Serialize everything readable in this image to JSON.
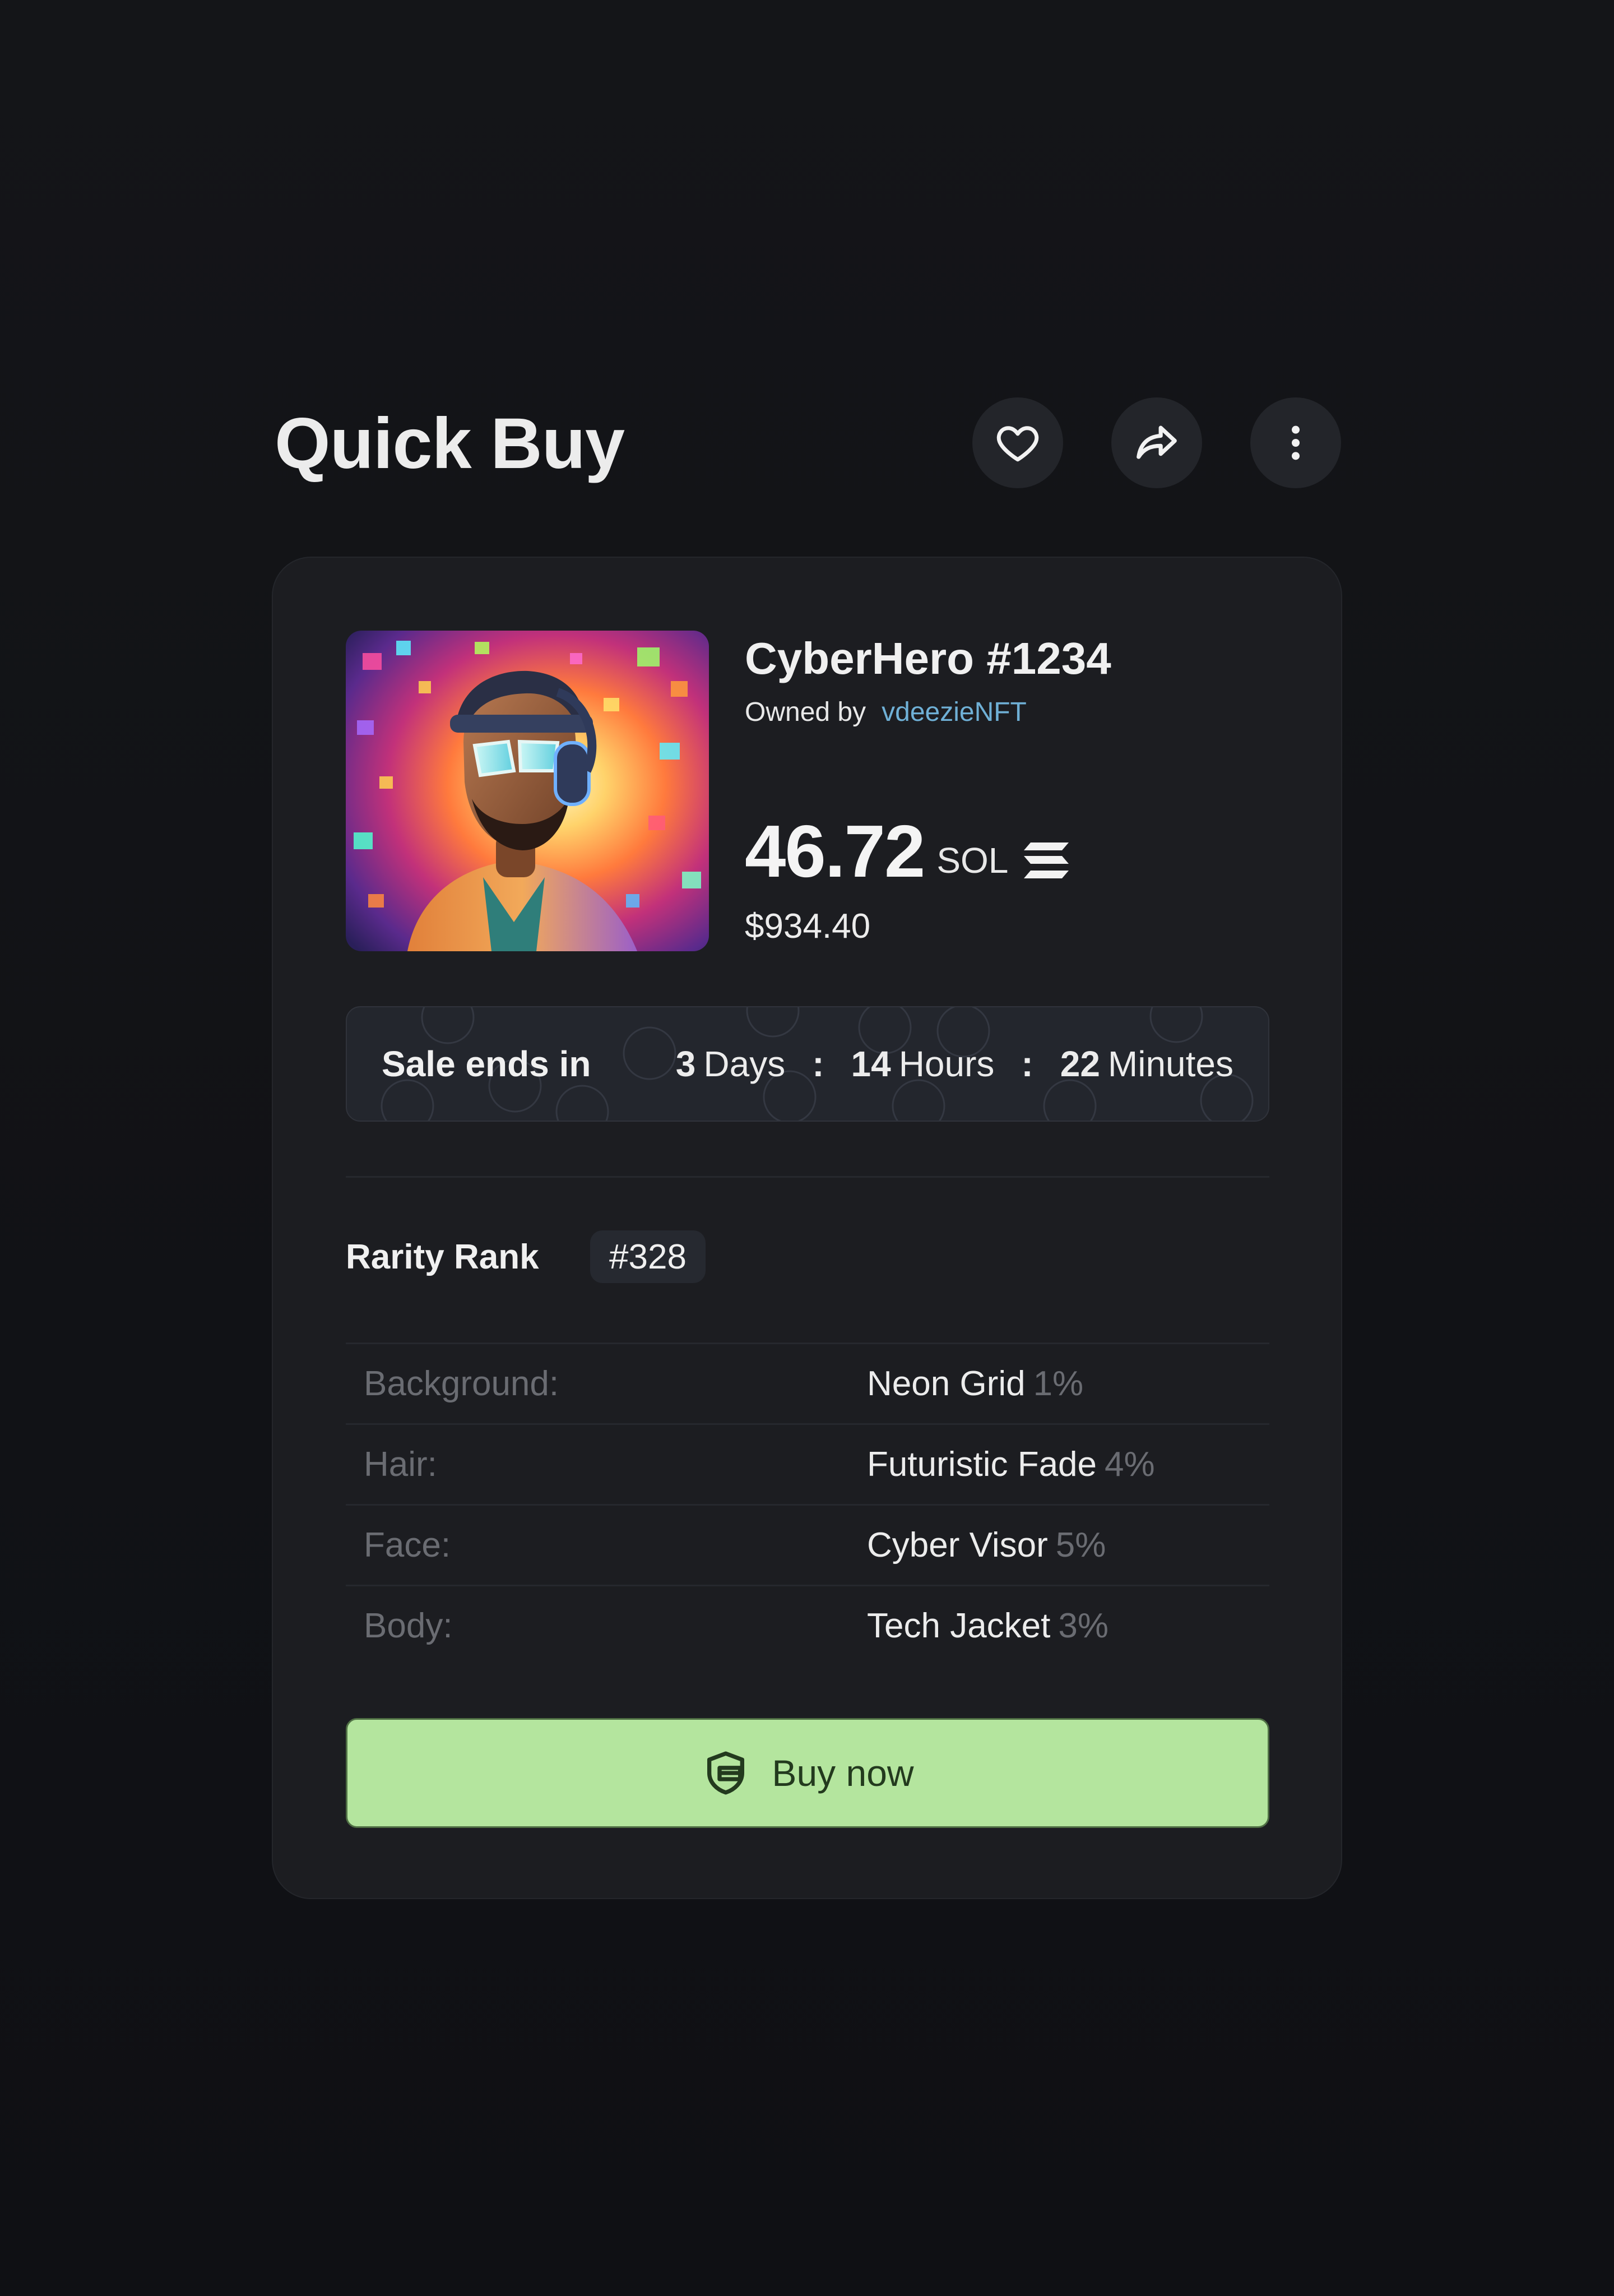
{
  "header": {
    "title": "Quick Buy",
    "actions": [
      {
        "icon": "heart-icon",
        "label": "Favorite"
      },
      {
        "icon": "share-icon",
        "label": "Share"
      },
      {
        "icon": "more-vertical-icon",
        "label": "More options"
      }
    ]
  },
  "nft": {
    "name": "CyberHero #1234",
    "owned_by_label": "Owned by",
    "owner": "vdeezieNFT",
    "price": "46.72",
    "currency": "SOL",
    "usd_price": "$934.40",
    "currency_icon": "solana-icon"
  },
  "sale": {
    "label": "Sale ends in",
    "days_value": "3",
    "days_unit": "Days",
    "hours_value": "14",
    "hours_unit": "Hours",
    "minutes_value": "22",
    "minutes_unit": "Minutes",
    "separator": ":"
  },
  "rarity": {
    "label": "Rarity Rank",
    "rank": "#328"
  },
  "traits": [
    {
      "key": "Background:",
      "value": "Neon Grid",
      "percent": "1%"
    },
    {
      "key": "Hair:",
      "value": "Futuristic Fade",
      "percent": "4%"
    },
    {
      "key": "Face:",
      "value": "Cyber Visor",
      "percent": "5%"
    },
    {
      "key": "Body:",
      "value": "Tech Jacket",
      "percent": "3%"
    }
  ],
  "buy": {
    "label": "Buy now",
    "icon": "wallet-shield-icon"
  },
  "colors": {
    "background": "#111216",
    "card": "#1c1d21",
    "accent_green": "#b4e59e",
    "owner_link": "#6fb0d6",
    "muted_text": "#6a6c72"
  }
}
